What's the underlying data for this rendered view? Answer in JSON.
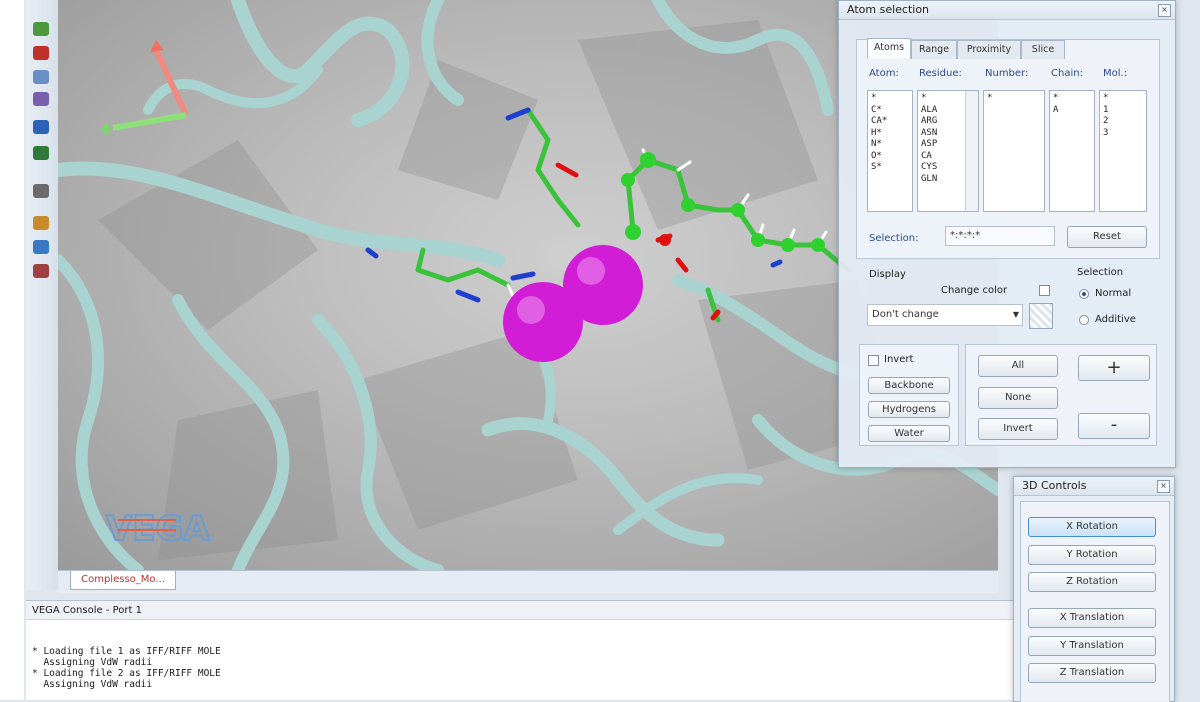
{
  "toolbar": {
    "tools": [
      {
        "icon": "open-file-icon",
        "color": "#4c9a3d"
      },
      {
        "icon": "stop-icon",
        "color": "#c0302b"
      },
      {
        "icon": "molecule-icon",
        "color": "#6a8fc4"
      },
      {
        "icon": "bonds-icon",
        "color": "#7a5fb0"
      },
      {
        "icon": "globe-icon",
        "color": "#2a63b8"
      },
      {
        "icon": "monitor-icon",
        "color": "#2f7a3a"
      },
      {
        "icon": "cursor-icon",
        "color": "#6b6b6b"
      },
      {
        "icon": "pencil-icon",
        "color": "#c88a2a"
      },
      {
        "icon": "paint-icon",
        "color": "#3a7ac4"
      },
      {
        "icon": "eraser-icon",
        "color": "#a04040"
      }
    ]
  },
  "viewport": {
    "logo_text": "VEGA",
    "document_tab": "Complesso_Mo..."
  },
  "console": {
    "title": "VEGA Console - Port 1",
    "lines": [
      "* Loading file 1 as IFF/RIFF MOLE",
      "  Assigning VdW radii",
      "* Loading file 2 as IFF/RIFF MOLE",
      "  Assigning VdW radii"
    ]
  },
  "atom_selection": {
    "title": "Atom selection",
    "tabs": [
      "Atoms",
      "Range",
      "Proximity",
      "Slice"
    ],
    "columns": {
      "atom": "Atom:",
      "residue": "Residue:",
      "number": "Number:",
      "chain": "Chain:",
      "mol": "Mol.:"
    },
    "atom_items": [
      "*",
      "C*",
      "CA*",
      "H*",
      "N*",
      "O*",
      "S*"
    ],
    "residue_items": [
      "*",
      "ALA",
      "ARG",
      "ASN",
      "ASP",
      "CA",
      "CYS",
      "GLN"
    ],
    "number_items": [
      "*"
    ],
    "chain_items": [
      "*",
      "A"
    ],
    "mol_items": [
      "*",
      "1",
      "2",
      "3"
    ],
    "selection_label": "Selection:",
    "selection_value": "*:*:*:*",
    "reset": "Reset",
    "display_label": "Display",
    "change_color": "Change color",
    "display_select": "Don't change",
    "selection_mode_label": "Selection",
    "mode_normal": "Normal",
    "mode_additive": "Additive",
    "invert_check": "Invert",
    "backbone": "Backbone",
    "hydrogens": "Hydrogens",
    "water": "Water",
    "all": "All",
    "none": "None",
    "invert": "Invert",
    "plus": "+",
    "minus": "-"
  },
  "controls_3d": {
    "title": "3D Controls",
    "buttons": [
      "X Rotation",
      "Y Rotation",
      "Z Rotation",
      "X Translation",
      "Y Translation",
      "Z Translation"
    ]
  },
  "colors": {
    "ribbon": "#a9d3d0",
    "carbon": "#39c23a",
    "oxygen": "#e01010",
    "nitrogen": "#1f3fd0",
    "ion": "#d11ed6"
  }
}
